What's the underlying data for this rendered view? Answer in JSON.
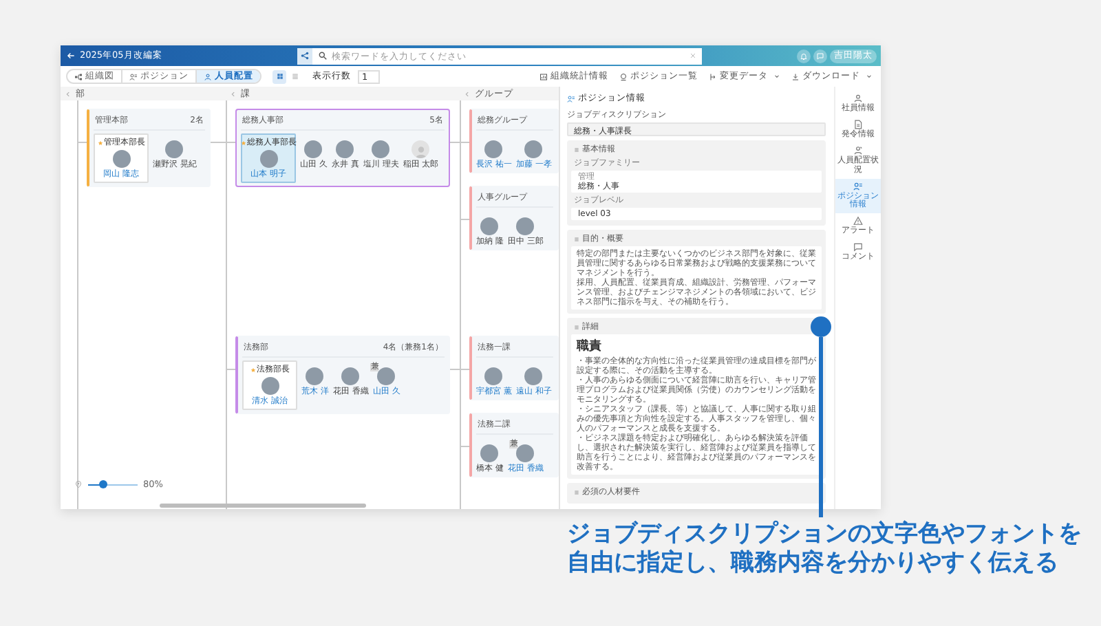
{
  "window": {
    "title": "2025年05月改編案"
  },
  "search": {
    "placeholder": "検索ワードを入力してください"
  },
  "user": {
    "label": "吉田陽太"
  },
  "view_tabs": [
    {
      "label": "組織図",
      "kind": "org",
      "selected": false
    },
    {
      "label": "ポジション",
      "kind": "position",
      "selected": false
    },
    {
      "label": "人員配置",
      "kind": "person",
      "selected": true
    }
  ],
  "layout_toggles": [
    {
      "kind": "grid",
      "selected": true
    },
    {
      "kind": "list",
      "selected": false
    }
  ],
  "rows_setting": {
    "label": "表示行数",
    "value": "1"
  },
  "toolbar": [
    {
      "label": "組織統計情報",
      "kind": "stats",
      "dropdown": false
    },
    {
      "label": "ポジション一覧",
      "kind": "positions",
      "dropdown": false
    },
    {
      "label": "変更データ",
      "kind": "changes",
      "dropdown": true
    },
    {
      "label": "ダウンロード",
      "kind": "download",
      "dropdown": true
    }
  ],
  "column_labels": [
    "部",
    "課",
    "グループ"
  ],
  "org_tree": {
    "title": "管理本部",
    "count": "2名",
    "color": "#f5b041",
    "selected": false,
    "members": [
      {
        "kind": "head",
        "role": "管理本部長",
        "name": "岡山 隆志",
        "photo": true,
        "linked": true,
        "selected": false
      },
      {
        "kind": "member",
        "name": "瀬野沢 晃紀",
        "photo": true,
        "linked": false,
        "selected": false
      }
    ],
    "children": [
      {
        "title": "総務人事部",
        "count": "5名",
        "color": "#c58be8",
        "selected": true,
        "members": [
          {
            "kind": "head",
            "role": "総務人事部長",
            "name": "山本 明子",
            "photo": true,
            "linked": true,
            "selected": true
          },
          {
            "kind": "member",
            "name": "山田 久",
            "photo": true,
            "linked": false,
            "selected": false
          },
          {
            "kind": "member",
            "name": "永井 真",
            "photo": true,
            "linked": false,
            "selected": false
          },
          {
            "kind": "member",
            "name": "塩川 理夫",
            "photo": true,
            "linked": false,
            "selected": false
          },
          {
            "kind": "member",
            "name": "稲田 太郎",
            "photo": false,
            "linked": false,
            "selected": false
          }
        ],
        "children": [
          {
            "title": "総務グループ",
            "color": "#f4a6a6",
            "selected": false,
            "members": [
              {
                "kind": "member",
                "name": "長沢 祐一",
                "photo": true,
                "linked": true,
                "selected": false
              },
              {
                "kind": "member",
                "name": "加藤 一孝",
                "photo": true,
                "linked": true,
                "selected": false
              }
            ]
          },
          {
            "title": "人事グループ",
            "color": "#f4a6a6",
            "selected": false,
            "members": [
              {
                "kind": "member",
                "name": "加納 隆",
                "photo": true,
                "linked": false,
                "selected": false
              },
              {
                "kind": "member",
                "name": "田中 三郎",
                "photo": true,
                "linked": false,
                "selected": false
              }
            ]
          }
        ]
      },
      {
        "title": "法務部",
        "count": "4名（兼務1名）",
        "color": "#c58be8",
        "selected": false,
        "members": [
          {
            "kind": "head",
            "role": "法務部長",
            "name": "清水 誠治",
            "photo": true,
            "linked": true,
            "selected": false
          },
          {
            "kind": "member",
            "name": "荒木 洋",
            "photo": true,
            "linked": true,
            "selected": false
          },
          {
            "kind": "member",
            "name": "花田 香織",
            "photo": true,
            "linked": false,
            "selected": false
          },
          {
            "kind": "member",
            "name": "山田 久",
            "photo": true,
            "linked": true,
            "selected": false,
            "badge": "兼"
          }
        ],
        "children": [
          {
            "title": "法務一課",
            "color": "#f4a6a6",
            "selected": false,
            "members": [
              {
                "kind": "member",
                "name": "宇都宮 薫",
                "photo": true,
                "linked": true,
                "selected": false
              },
              {
                "kind": "member",
                "name": "遠山 和子",
                "photo": true,
                "linked": true,
                "selected": false
              }
            ]
          },
          {
            "title": "法務二課",
            "color": "#f4a6a6",
            "selected": false,
            "members": [
              {
                "kind": "member",
                "name": "橋本 健",
                "photo": true,
                "linked": false,
                "selected": false
              },
              {
                "kind": "member",
                "name": "花田 香織",
                "photo": true,
                "linked": true,
                "selected": false,
                "badge": "兼"
              }
            ]
          }
        ]
      }
    ]
  },
  "zoom": {
    "level": 0.3,
    "reading": "80%"
  },
  "panel": {
    "title": "ポジション情報",
    "jd_label": "ジョブディスクリプション",
    "jd_value": "総務・人事課長",
    "sections": [
      {
        "kind": "fields",
        "title": "基本情報",
        "fields": [
          {
            "label": "ジョブファミリー",
            "sublabel": "管理",
            "value": "総務・人事"
          },
          {
            "label": "ジョブレベル",
            "value": "level 03"
          }
        ]
      },
      {
        "kind": "text",
        "title": "目的・概要",
        "paragraphs": [
          "特定の部門または主要ないくつかのビジネス部門を対象に、従業員管理に関するあらゆる日常業務および戦略的支援業務についてマネジメントを行う。",
          "採用、人員配置、従業員育成、組織設計、労務管理、パフォーマンス管理、およびチェンジマネジメントの各領域において、ビジネス部門に指示を与え、その補助を行う。"
        ]
      },
      {
        "kind": "text",
        "title": "詳細",
        "heading": "職責",
        "paragraphs": [
          "・事業の全体的な方向性に沿った従業員管理の達成目標を部門が設定する際に、その活動を主導する。",
          "・人事のあらゆる側面について経営陣に助言を行い、キャリア管理プログラムおよび従業員関係（労使）のカウンセリング活動をモニタリングする。",
          "・シニアスタッフ（課長、等）と協議して、人事に関する取り組みの優先事項と方向性を設定する。人事スタッフを管理し、個々人のパフォーマンスと成長を支援する。",
          "・ビジネス課題を特定および明確化し、あらゆる解決策を評価し、選択された解決策を実行し、経営陣および従業員を指導して助言を行うことにより、経営陣および従業員のパフォーマンスを改善する。"
        ]
      },
      {
        "kind": "text",
        "title": "必須の人材要件"
      }
    ]
  },
  "sidebar": [
    {
      "label": "社員情報",
      "kind": "person",
      "selected": false
    },
    {
      "label": "発令情報",
      "kind": "document",
      "selected": false
    },
    {
      "label": "人員配置状況",
      "kind": "placement",
      "selected": false
    },
    {
      "label": "ポジション情報",
      "kind": "position",
      "selected": true
    },
    {
      "label": "アラート",
      "kind": "alert",
      "selected": false
    },
    {
      "label": "コメント",
      "kind": "comment",
      "selected": false
    }
  ],
  "caption": {
    "lines": [
      "ジョブディスクリプションの文字色やフォントを",
      "自由に指定し、職務内容を分かりやすく伝える"
    ]
  }
}
